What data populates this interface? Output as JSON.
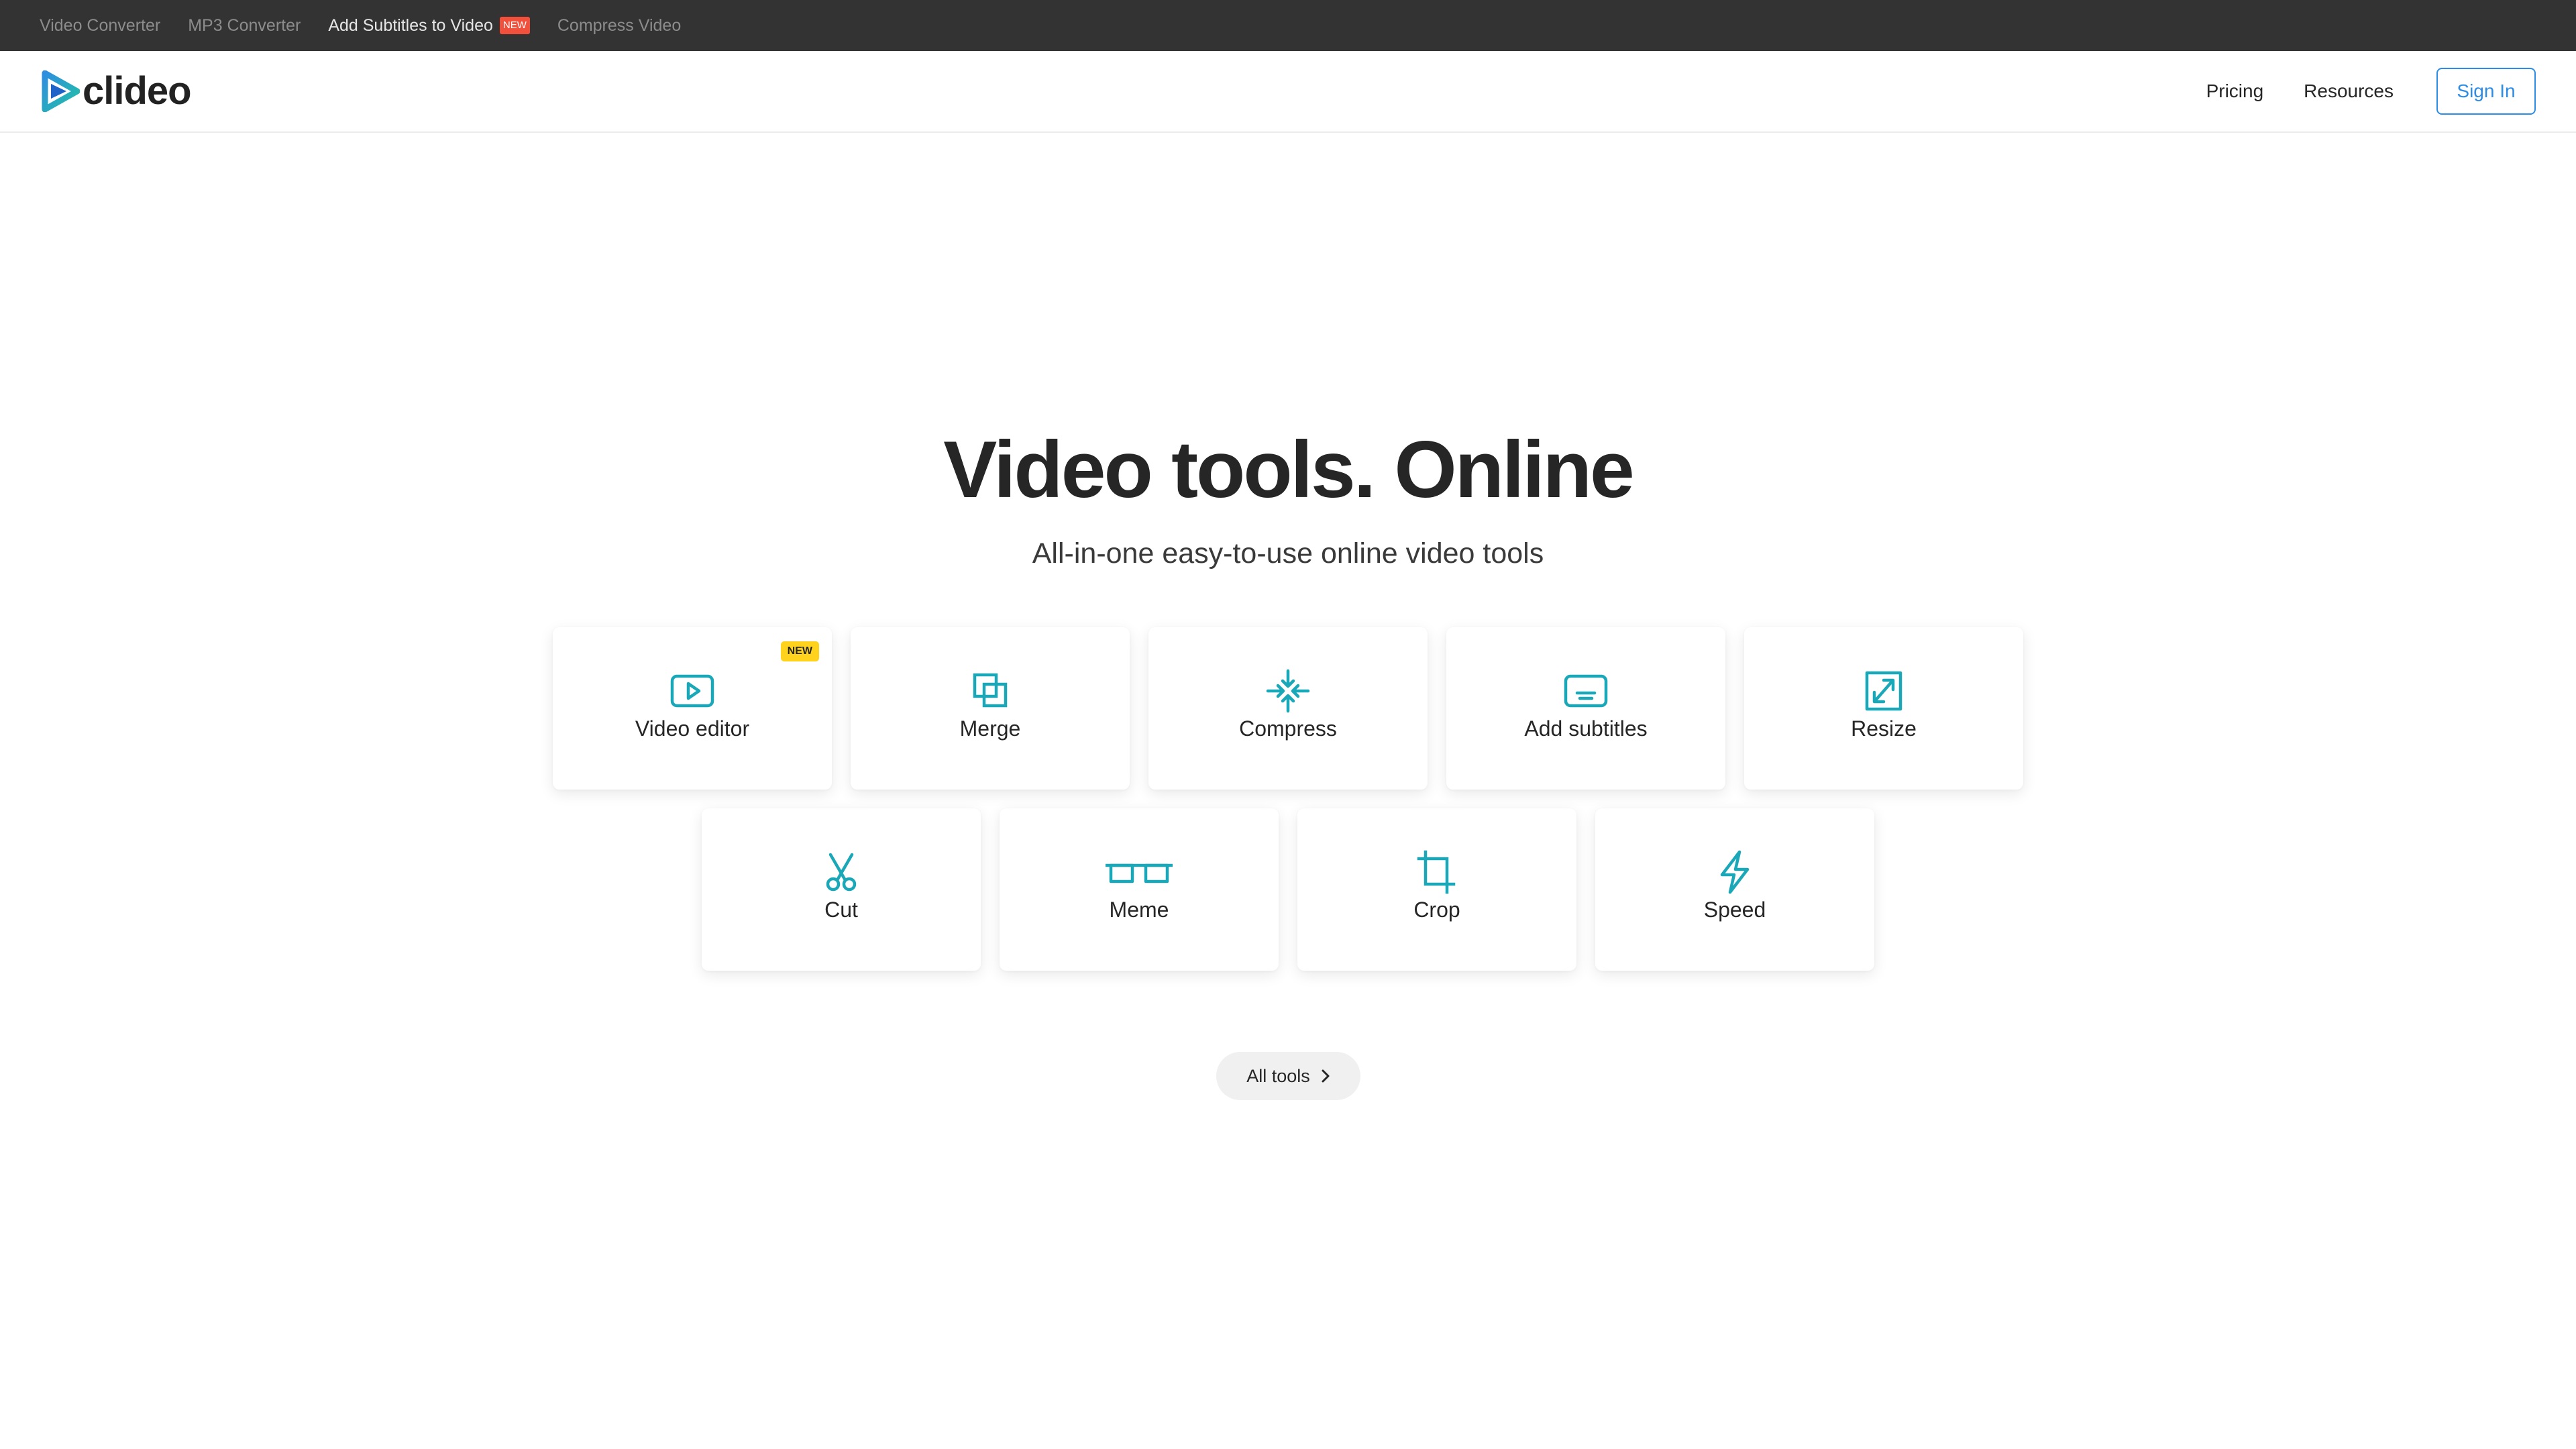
{
  "promo_bar": {
    "links": [
      "Video Converter",
      "MP3 Converter",
      "Add Subtitles to Video",
      "Compress Video"
    ],
    "new_badge": "NEW"
  },
  "header": {
    "logo_text": "clideo",
    "nav": [
      "Pricing",
      "Resources"
    ],
    "sign_in": "Sign In"
  },
  "hero": {
    "title": "Video tools. Online",
    "subtitle": "All-in-one easy-to-use online video tools"
  },
  "tools": {
    "row1": [
      {
        "label": "Video editor",
        "icon": "play-icon",
        "badge": "NEW"
      },
      {
        "label": "Merge",
        "icon": "merge-icon"
      },
      {
        "label": "Compress",
        "icon": "compress-icon"
      },
      {
        "label": "Add subtitles",
        "icon": "subtitles-icon"
      },
      {
        "label": "Resize",
        "icon": "resize-icon"
      }
    ],
    "row2": [
      {
        "label": "Cut",
        "icon": "scissors-icon"
      },
      {
        "label": "Meme",
        "icon": "meme-icon"
      },
      {
        "label": "Crop",
        "icon": "crop-icon"
      },
      {
        "label": "Speed",
        "icon": "lightning-icon"
      }
    ]
  },
  "all_tools": "All tools",
  "colors": {
    "accent_teal": "#1aa7b8",
    "sign_in_blue": "#2d8ce6",
    "new_badge_yellow": "#ffd21e",
    "promo_badge_red": "#f0503c",
    "promo_bar_bg": "#333333"
  }
}
